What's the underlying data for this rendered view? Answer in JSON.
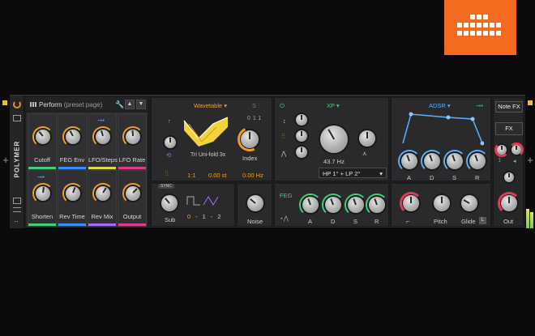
{
  "device": {
    "name": "POLYMER",
    "preset_page": "Perform",
    "preset_page_suffix": "(preset page)",
    "add_left": "+",
    "add_right": "+"
  },
  "perform": {
    "cells": [
      {
        "label": "Cutoff",
        "bar_color": "#3fd07a",
        "icon": ""
      },
      {
        "label": "FEG Env",
        "bar_color": "#3b8cff",
        "icon": ""
      },
      {
        "label": "LFO/Steps",
        "bar_color": "#e4d83a",
        "icon": "lfo-route-icon"
      },
      {
        "label": "LFO Rate",
        "bar_color": "#e03a8c",
        "icon": ""
      },
      {
        "label": "Shorten",
        "bar_color": "#3fd07a",
        "icon": "lfo-route-icon"
      },
      {
        "label": "Rev Time",
        "bar_color": "#3b8cff",
        "icon": ""
      },
      {
        "label": "Rev Mix",
        "bar_color": "#a06cff",
        "icon": ""
      },
      {
        "label": "Output",
        "bar_color": "#e03a8c",
        "icon": ""
      }
    ]
  },
  "oscillator": {
    "type": "Wavetable",
    "wavetable_name": "Tri Uni-fold 3x",
    "index_label": "Index",
    "ratio": "1:1",
    "semitones": "0.00 st",
    "hz": "0.00 Hz",
    "step_values": [
      "0",
      "1",
      "1"
    ],
    "sub_label": "Sub",
    "sub_steps": [
      "0",
      "-1",
      "-2"
    ],
    "sub_badge": "SYNC",
    "noise_label": "Noise"
  },
  "filter": {
    "type": "XP",
    "freq": "43.7 Hz",
    "mode": "HP 1° + LP 2°",
    "feg_label": "FEG",
    "adsr": [
      "A",
      "D",
      "S",
      "R"
    ]
  },
  "envelope": {
    "type": "ADSR",
    "adsr": [
      "A",
      "D",
      "S",
      "R"
    ],
    "pitch_label": "Pitch",
    "glide_label": "Glide",
    "glide_badge": "L"
  },
  "fx": {
    "note_fx": "Note FX",
    "fx": "FX",
    "out_label": "Out"
  },
  "colors": {
    "accent": "#f0a020",
    "green": "#3fd07a",
    "blue": "#5ab0ff",
    "brand": "#f46a1f"
  }
}
